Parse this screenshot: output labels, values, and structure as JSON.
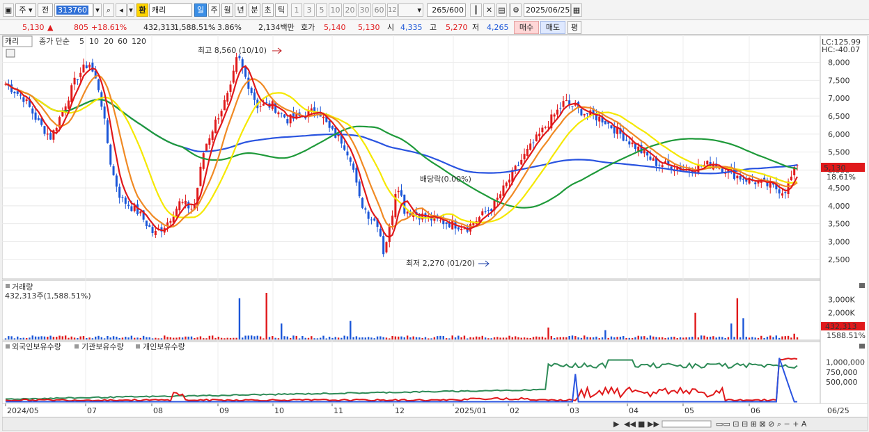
{
  "toolbar": {
    "market": "주",
    "type": "전",
    "code": "313760",
    "yellow_tag": "환",
    "name": "캐리",
    "periods": [
      "일",
      "주",
      "월",
      "년",
      "분",
      "초",
      "틱"
    ],
    "active_period": "일",
    "intervals": [
      "1",
      "3",
      "5",
      "10",
      "20",
      "30",
      "60",
      "120"
    ],
    "count": "265",
    "count_max": "/600",
    "date": "2025/06/25"
  },
  "quote": {
    "price": "5,130",
    "change": "805",
    "change_pct": "+18.61%",
    "volume": "432,313",
    "volume_ratio": "1,588.51%",
    "turnover": "3.86%",
    "amount": "2,134백만",
    "bid_label": "호가",
    "bid1": "5,140",
    "bid2": "5,130",
    "open_label": "시",
    "open": "4,335",
    "high_label": "고",
    "high": "5,270",
    "low_label": "저",
    "low": "4,265",
    "buy_label": "매수",
    "sell_label": "매도",
    "eval_label": "평"
  },
  "colors": {
    "up": "#e0191b",
    "down": "#1b56d8",
    "ma5": "#e0191b",
    "ma10": "#f08a24",
    "ma20": "#f5e800",
    "ma60": "#1f9a3a",
    "ma120": "#2a54e0",
    "foreign": "#e0191b",
    "institution": "#2a54e0",
    "individual": "#2e8b57"
  },
  "price_panel": {
    "name": "캐리",
    "legend_prefix": "종가 단순",
    "ma_periods": [
      "5",
      "10",
      "20",
      "60",
      "120"
    ],
    "lc": "LC:125.99",
    "hc": "HC:-40.07",
    "y_ticks": [
      "8,000",
      "7,500",
      "7,000",
      "6,500",
      "6,000",
      "5,500",
      "5,000",
      "4,500",
      "4,000",
      "3,500",
      "3,000",
      "2,500"
    ],
    "last_price": "5,130",
    "last_pct": "18.61%",
    "high_note": "최고 8,560 (10/10)",
    "low_note": "최저 2,270 (01/20)",
    "dividend_note": "배당락(0.00%)"
  },
  "volume_panel": {
    "title": "거래량",
    "value": "432,313주(1,588.51%)",
    "y_ticks": [
      "3,000K",
      "2,000K",
      "1,000K"
    ],
    "last": "432,313",
    "last_pct": "1588.51%"
  },
  "holding_panel": {
    "series": [
      "외국인보유수량",
      "기관보유수량",
      "개인보유수량"
    ],
    "y_ticks": [
      "1,000,000",
      "750,000",
      "500,000"
    ]
  },
  "x_axis": {
    "labels": [
      "2024/05",
      "07",
      "08",
      "09",
      "10",
      "11",
      "12",
      "2025/01",
      "02",
      "03",
      "04",
      "05",
      "06",
      "06/25"
    ]
  },
  "chart_data": {
    "type": "line",
    "price_ylim": [
      2000,
      8400
    ],
    "monthly_close_approx": [
      {
        "x": "2024/05",
        "y": 7400
      },
      {
        "x": "2024/06",
        "y": 6200
      },
      {
        "x": "2024/07",
        "y": 7700
      },
      {
        "x": "2024/08",
        "y": 3300
      },
      {
        "x": "2024/09",
        "y": 3900
      },
      {
        "x": "2024/10",
        "y": 7500
      },
      {
        "x": "2024/11",
        "y": 6500
      },
      {
        "x": "2024/12",
        "y": 6000
      },
      {
        "x": "2025/01",
        "y": 3300
      },
      {
        "x": "2025/02",
        "y": 4200
      },
      {
        "x": "2025/03",
        "y": 3500
      },
      {
        "x": "2025/04",
        "y": 6800
      },
      {
        "x": "2025/05",
        "y": 5100
      },
      {
        "x": "2025/06",
        "y": 5130
      }
    ],
    "series": [
      {
        "name": "5"
      },
      {
        "name": "10"
      },
      {
        "name": "20"
      },
      {
        "name": "60"
      },
      {
        "name": "120"
      }
    ],
    "volume_ylim": [
      0,
      3500000
    ],
    "holding_ylim": [
      0,
      1250000
    ],
    "holding_series": [
      {
        "name": "외국인보유수량",
        "last": 1100000
      },
      {
        "name": "기관보유수량",
        "last": 10000
      },
      {
        "name": "개인보유수량",
        "last": 950000
      }
    ]
  }
}
